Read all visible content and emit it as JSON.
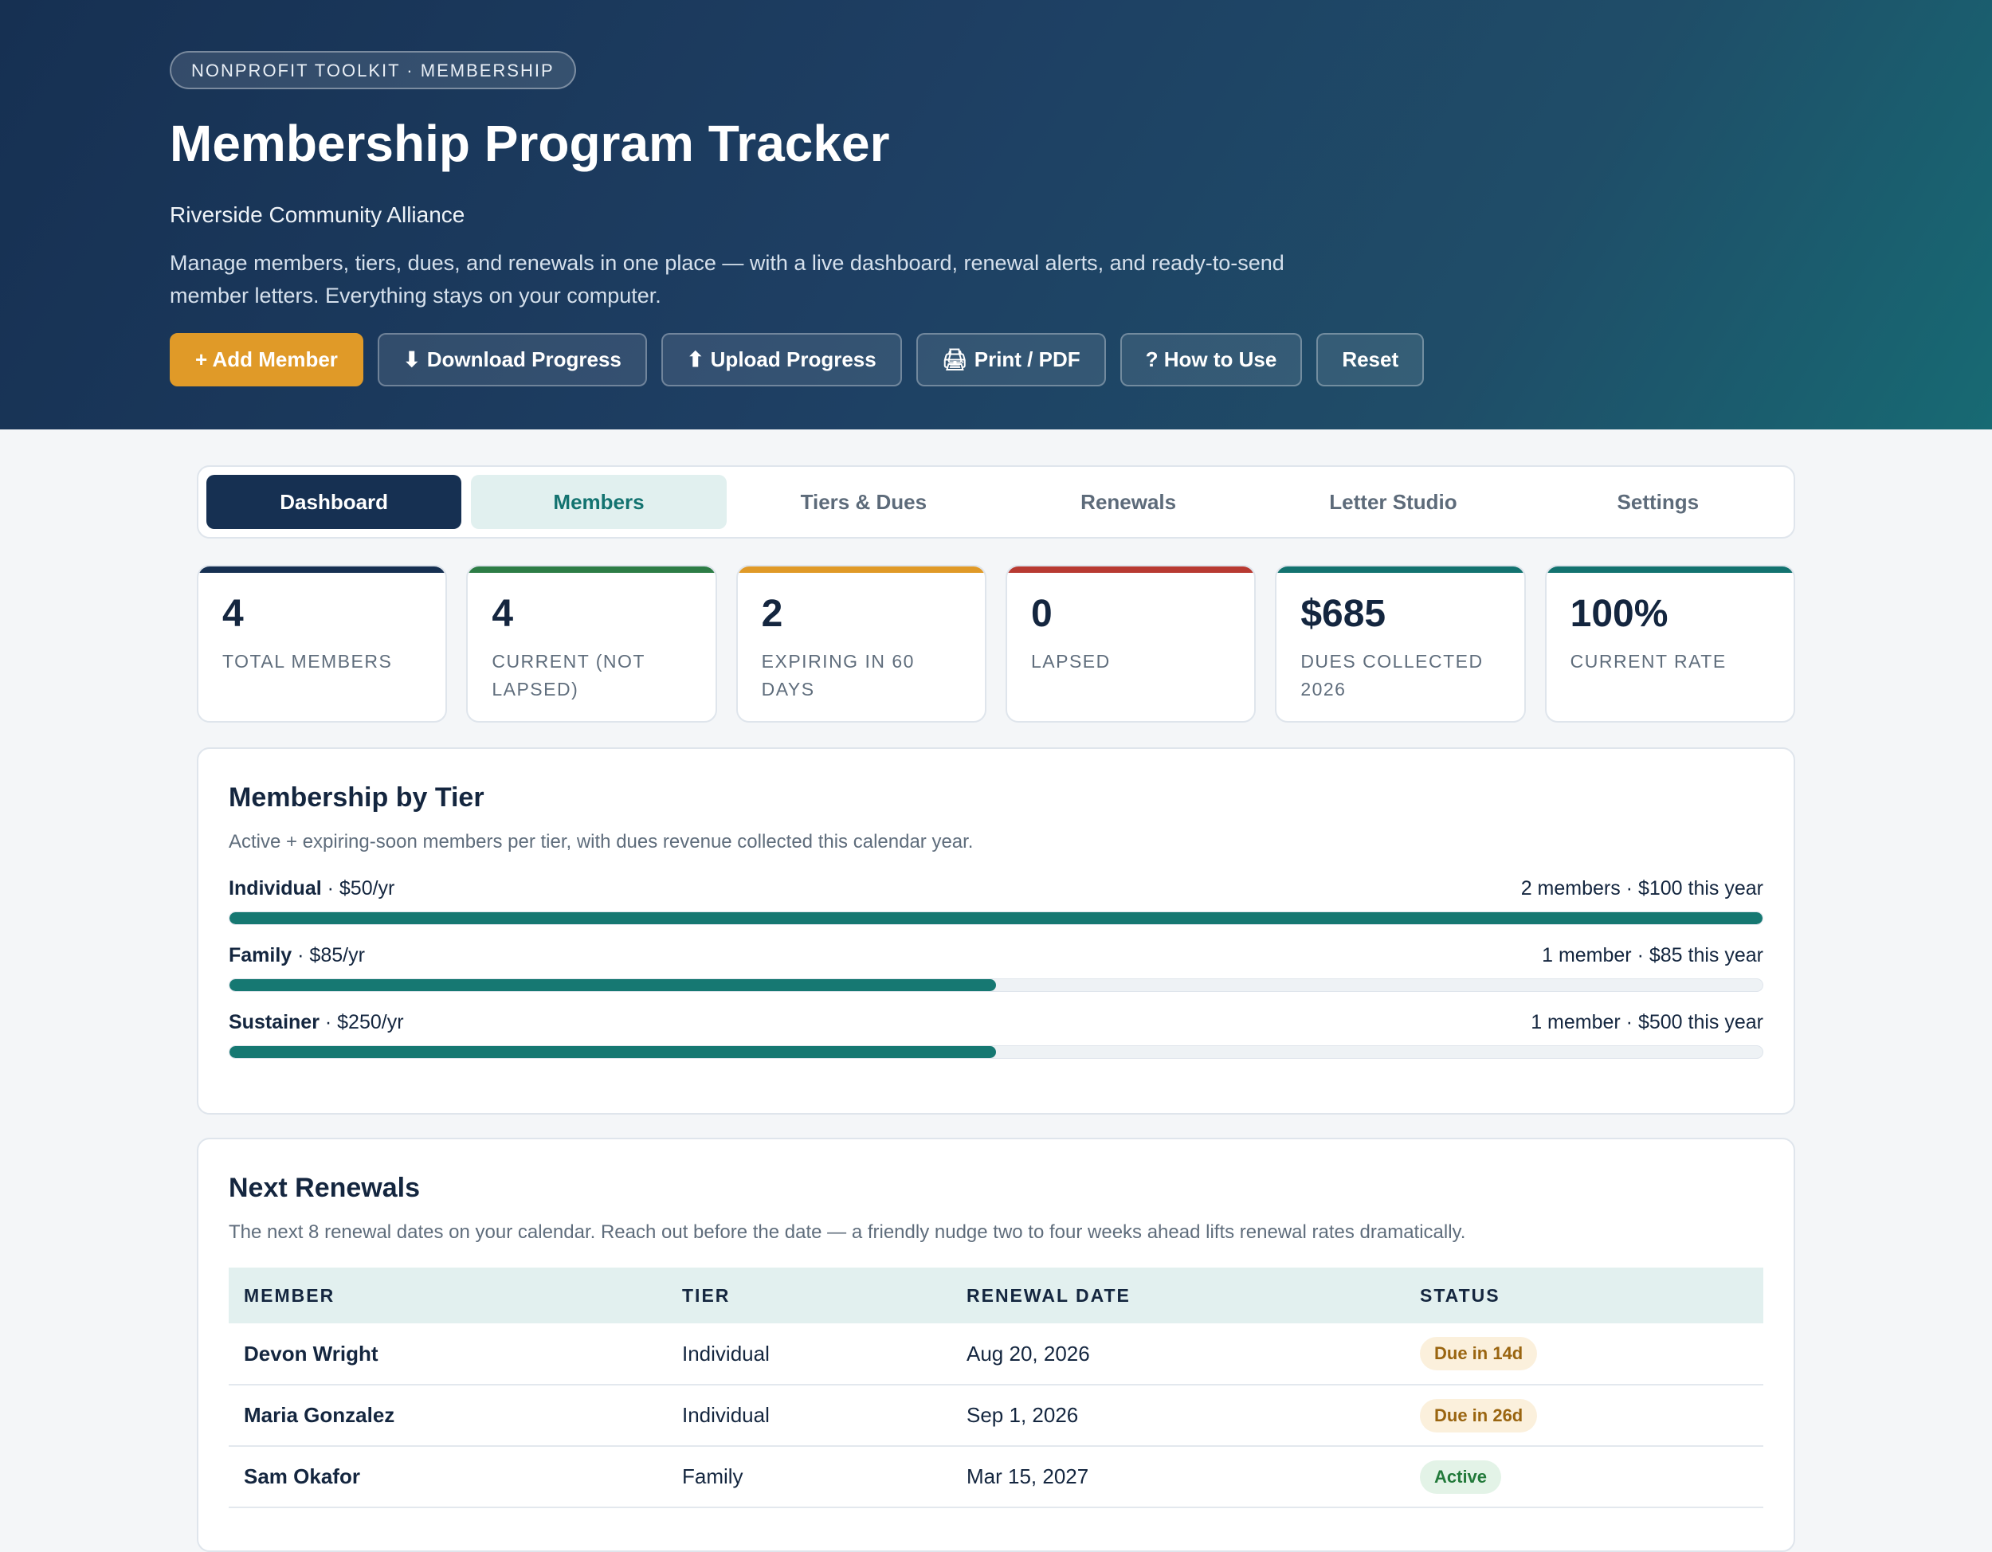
{
  "hero": {
    "eyebrow": "NONPROFIT TOOLKIT · MEMBERSHIP",
    "title": "Membership Program Tracker",
    "org": "Riverside Community Alliance",
    "description": "Manage members, tiers, dues, and renewals in one place — with a live dashboard, renewal alerts, and ready-to-send member letters. Everything stays on your computer.",
    "actions": [
      {
        "label": "+ Add Member",
        "icon": ""
      },
      {
        "label": "Download Progress",
        "icon": "⬇"
      },
      {
        "label": "Upload Progress",
        "icon": "⬆"
      },
      {
        "label": "Print / PDF",
        "icon": "🖨"
      },
      {
        "label": "? How to Use",
        "icon": ""
      },
      {
        "label": "Reset",
        "icon": ""
      }
    ]
  },
  "tabs": [
    "Dashboard",
    "Members",
    "Tiers & Dues",
    "Renewals",
    "Letter Studio",
    "Settings"
  ],
  "stats": [
    {
      "value": "4",
      "label": "Total Members",
      "accent": "#163052"
    },
    {
      "value": "4",
      "label": "Current (not lapsed)",
      "accent": "#2d7d46"
    },
    {
      "value": "2",
      "label": "Expiring in 60 days",
      "accent": "#e09a28"
    },
    {
      "value": "0",
      "label": "Lapsed",
      "accent": "#b83a32"
    },
    {
      "value": "$685",
      "label": "Dues collected 2026",
      "accent": "#137370"
    },
    {
      "value": "100%",
      "label": "Current rate",
      "accent": "#137370"
    }
  ],
  "tiers_panel": {
    "title": "Membership by Tier",
    "subtitle": "Active + expiring-soon members per tier, with dues revenue collected this calendar year.",
    "rows": [
      {
        "name": "Individual",
        "price": " · $50/yr",
        "summary": "2 members · $100 this year",
        "fill": 1.0
      },
      {
        "name": "Family",
        "price": " · $85/yr",
        "summary": "1 member · $85 this year",
        "fill": 0.5
      },
      {
        "name": "Sustainer",
        "price": " · $250/yr",
        "summary": "1 member · $500 this year",
        "fill": 0.5
      }
    ]
  },
  "renewals_panel": {
    "title": "Next Renewals",
    "subtitle": "The next 8 renewal dates on your calendar. Reach out before the date — a friendly nudge two to four weeks ahead lifts renewal rates dramatically.",
    "columns": [
      "MEMBER",
      "TIER",
      "RENEWAL DATE",
      "STATUS"
    ],
    "rows": [
      {
        "member": "Devon Wright",
        "tier": "Individual",
        "date": "Aug 20, 2026",
        "status": "Due in 14d",
        "kind": "due"
      },
      {
        "member": "Maria Gonzalez",
        "tier": "Individual",
        "date": "Sep 1, 2026",
        "status": "Due in 26d",
        "kind": "due"
      },
      {
        "member": "Sam Okafor",
        "tier": "Family",
        "date": "Mar 15, 2027",
        "status": "Active",
        "kind": "active"
      }
    ]
  }
}
